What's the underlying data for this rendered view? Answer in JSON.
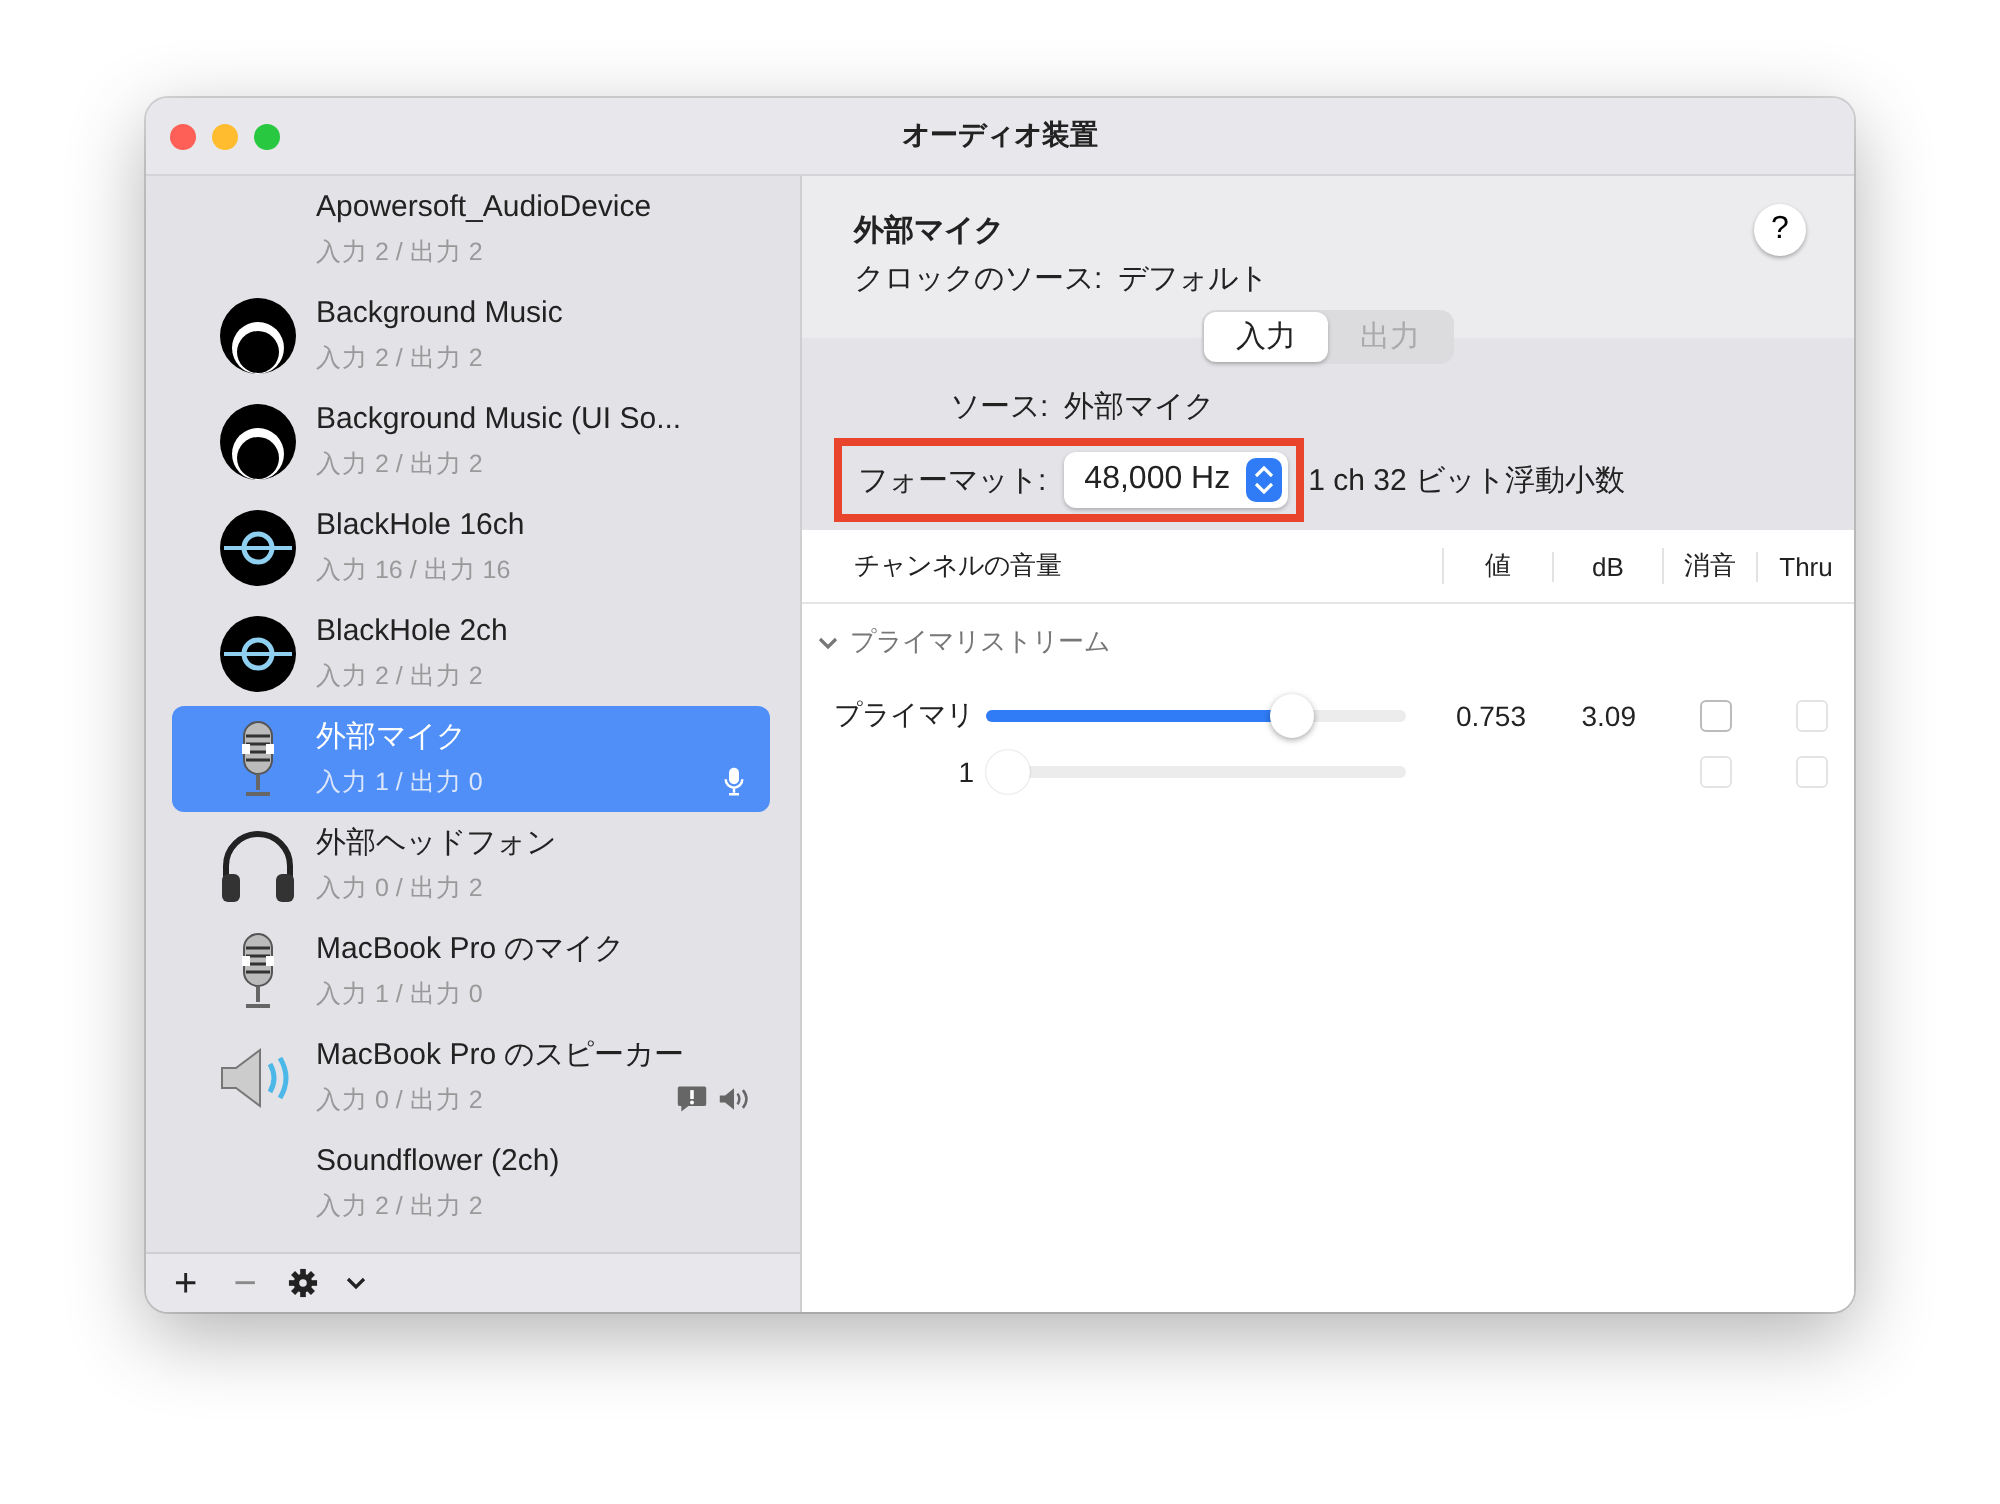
{
  "window": {
    "title": "オーディオ装置"
  },
  "devices": [
    {
      "name": "Apowersoft_AudioDevice",
      "io": "入力 2 / 出力 2",
      "kind": "none",
      "selected": false,
      "default_input": false,
      "default_output": false,
      "alert": false
    },
    {
      "name": "Background Music",
      "io": "入力 2 / 出力 2",
      "kind": "bgm",
      "selected": false,
      "default_input": false,
      "default_output": false,
      "alert": false
    },
    {
      "name": "Background Music (UI So...",
      "io": "入力 2 / 出力 2",
      "kind": "bgm",
      "selected": false,
      "default_input": false,
      "default_output": false,
      "alert": false
    },
    {
      "name": "BlackHole 16ch",
      "io": "入力 16 / 出力 16",
      "kind": "blackhole",
      "selected": false,
      "default_input": false,
      "default_output": false,
      "alert": false
    },
    {
      "name": "BlackHole 2ch",
      "io": "入力 2 / 出力 2",
      "kind": "blackhole",
      "selected": false,
      "default_input": false,
      "default_output": false,
      "alert": false
    },
    {
      "name": "外部マイク",
      "io": "入力 1 / 出力 0",
      "kind": "mic",
      "selected": true,
      "default_input": true,
      "default_output": false,
      "alert": false
    },
    {
      "name": "外部ヘッドフォン",
      "io": "入力 0 / 出力 2",
      "kind": "headphones",
      "selected": false,
      "default_input": false,
      "default_output": false,
      "alert": false
    },
    {
      "name": "MacBook Pro のマイク",
      "io": "入力 1 / 出力 0",
      "kind": "mic",
      "selected": false,
      "default_input": false,
      "default_output": false,
      "alert": false
    },
    {
      "name": "MacBook Pro のスピーカー",
      "io": "入力 0 / 出力 2",
      "kind": "speaker",
      "selected": false,
      "default_input": false,
      "default_output": true,
      "alert": true
    },
    {
      "name": "Soundflower (2ch)",
      "io": "入力 2 / 出力 2",
      "kind": "none",
      "selected": false,
      "default_input": false,
      "default_output": false,
      "alert": false
    }
  ],
  "toolbar": {
    "add": "+",
    "remove": "−"
  },
  "detail": {
    "title": "外部マイク",
    "help": "?",
    "clock_label": "クロックのソース:",
    "clock_value": "デフォルト",
    "tabs": [
      {
        "label": "入力",
        "selected": true
      },
      {
        "label": "出力",
        "selected": false
      }
    ],
    "source_label": "ソース:",
    "source_value": "外部マイク",
    "format_label": "フォーマット:",
    "format_value": "48,000 Hz",
    "format_highlighted": true,
    "format_detail": "1 ch 32 ビット浮動小数",
    "columns": [
      "チャンネルの音量",
      "値",
      "dB",
      "消音",
      "Thru"
    ],
    "stream": {
      "label": "プライマリストリーム",
      "expanded": true
    },
    "channels": [
      {
        "name": "プライマリ",
        "level": 0.753,
        "value": "0.753",
        "db": "3.09",
        "enabled": true,
        "mute": {
          "checked": false,
          "disabled": false
        },
        "thru": {
          "checked": false,
          "disabled": true
        }
      },
      {
        "name": "1",
        "level": 0,
        "enabled": false,
        "mute": {
          "checked": false,
          "disabled": true
        },
        "thru": {
          "checked": false,
          "disabled": true
        }
      }
    ]
  }
}
